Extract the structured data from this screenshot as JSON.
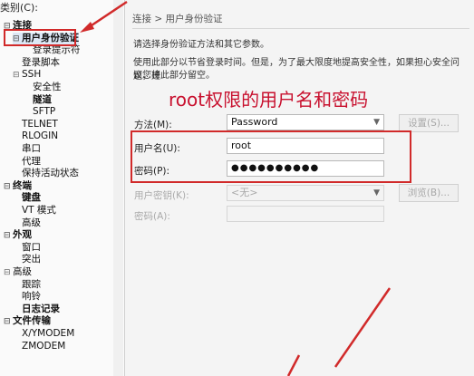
{
  "tree": {
    "title": "类别(C):",
    "items": [
      {
        "label": "连接",
        "level": 0,
        "toggle": "⊟",
        "bold": true
      },
      {
        "label": "用户身份验证",
        "level": 1,
        "toggle": "⊟",
        "bold": true,
        "selected": true
      },
      {
        "label": "登录提示符",
        "level": 2
      },
      {
        "label": "登录脚本",
        "level": 1
      },
      {
        "label": "SSH",
        "level": 1,
        "toggle": "⊟"
      },
      {
        "label": "安全性",
        "level": 2
      },
      {
        "label": "隧道",
        "level": 2,
        "bold": true
      },
      {
        "label": "SFTP",
        "level": 2
      },
      {
        "label": "TELNET",
        "level": 1
      },
      {
        "label": "RLOGIN",
        "level": 1
      },
      {
        "label": "串口",
        "level": 1
      },
      {
        "label": "代理",
        "level": 1
      },
      {
        "label": "保持活动状态",
        "level": 1
      },
      {
        "label": "终端",
        "level": 0,
        "toggle": "⊟",
        "bold": true
      },
      {
        "label": "键盘",
        "level": 1,
        "bold": true
      },
      {
        "label": "VT 模式",
        "level": 1
      },
      {
        "label": "高级",
        "level": 1
      },
      {
        "label": "外观",
        "level": 0,
        "toggle": "⊟",
        "bold": true
      },
      {
        "label": "窗口",
        "level": 1
      },
      {
        "label": "突出",
        "level": 1
      },
      {
        "label": "高级",
        "level": 0,
        "toggle": "⊟"
      },
      {
        "label": "跟踪",
        "level": 1
      },
      {
        "label": "响铃",
        "level": 1
      },
      {
        "label": "日志记录",
        "level": 1,
        "bold": true
      },
      {
        "label": "文件传输",
        "level": 0,
        "toggle": "⊟",
        "bold": true
      },
      {
        "label": "X/YMODEM",
        "level": 1
      },
      {
        "label": "ZMODEM",
        "level": 1
      }
    ]
  },
  "content": {
    "breadcrumb": "连接 > 用户身份验证",
    "intro": "请选择身份验证方法和其它参数。",
    "desc1": "使用此部分以节省登录时间。但是，为了最大限度地提高安全性，如果担心安全问题，建",
    "desc2": "议您将此部分留空。",
    "headline": "root权限的用户名和密码",
    "method_label": "方法(M):",
    "method_value": "Password",
    "settings_button": "设置(S)...",
    "username_label": "用户名(U):",
    "username_value": "root",
    "password_label": "密码(P):",
    "password_value": "●●●●●●●●●●",
    "userkey_label": "用户密钥(K):",
    "userkey_value": "<无>",
    "browse_button": "浏览(B)...",
    "passphrase_label": "密码(A):"
  },
  "colors": {
    "annotation": "#d12a2a",
    "headline": "#c8102e"
  }
}
